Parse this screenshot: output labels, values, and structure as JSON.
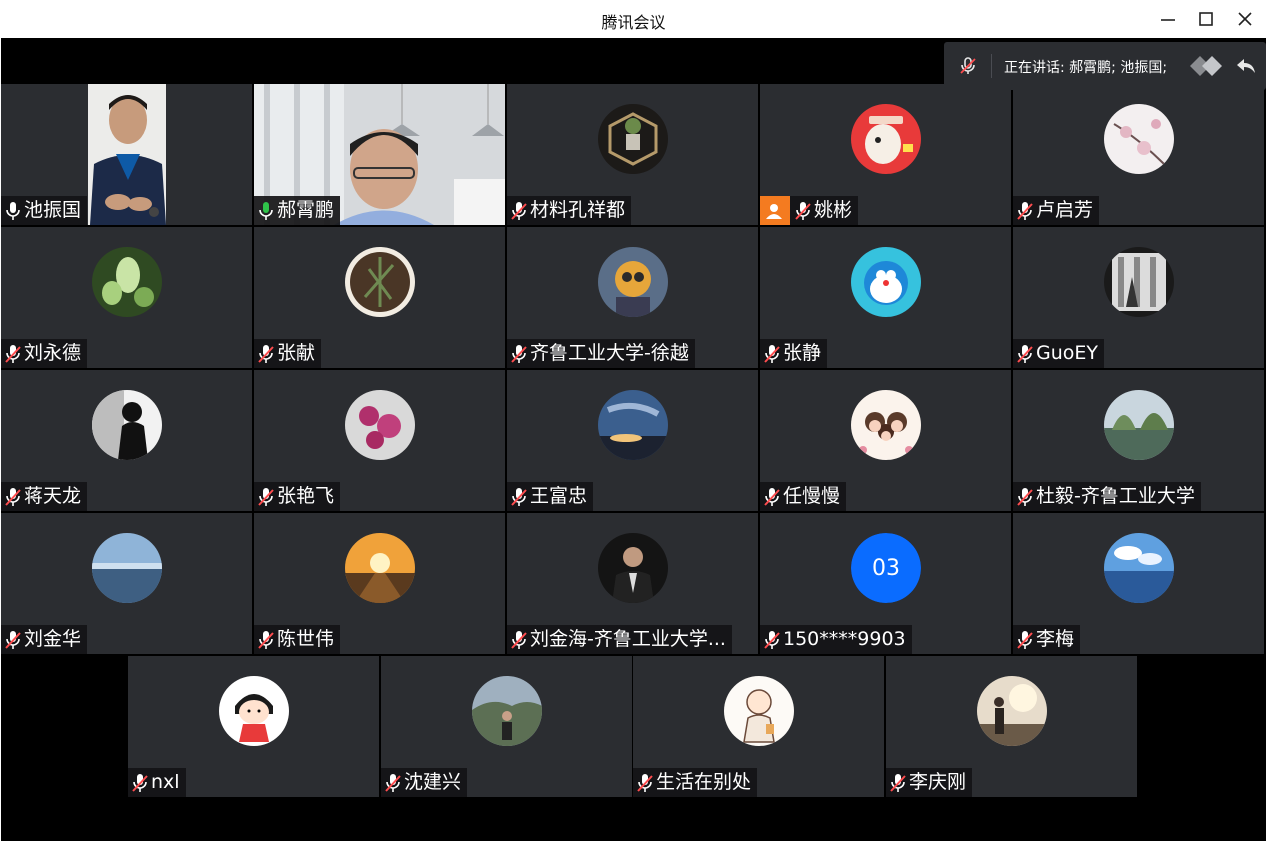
{
  "window": {
    "title": "腾讯会议",
    "controls": [
      "minimize-icon",
      "maximize-icon",
      "close-icon"
    ]
  },
  "speaking": {
    "label": "正在讲话: 郝霄鹏; 池振国;"
  },
  "colors": {
    "tile_bg": "#2b2d31",
    "stage_bg": "#000000",
    "active_border": "#2fc34a",
    "host_badge": "#f47b20",
    "number_avatar": "#0a6cff"
  },
  "participants": [
    {
      "name": "池振国",
      "mic": "on",
      "video": true
    },
    {
      "name": "郝霄鹏",
      "mic": "speaking",
      "video": true
    },
    {
      "name": "材料孔祥都",
      "mic": "muted"
    },
    {
      "name": "姚彬",
      "mic": "muted",
      "host": true
    },
    {
      "name": "卢启芳",
      "mic": "muted"
    },
    {
      "name": "刘永德",
      "mic": "muted"
    },
    {
      "name": "张献",
      "mic": "muted"
    },
    {
      "name": "齐鲁工业大学-徐越",
      "mic": "muted"
    },
    {
      "name": "张静",
      "mic": "muted"
    },
    {
      "name": "GuoEY",
      "mic": "muted"
    },
    {
      "name": "蒋天龙",
      "mic": "muted"
    },
    {
      "name": "张艳飞",
      "mic": "muted"
    },
    {
      "name": "王富忠",
      "mic": "muted"
    },
    {
      "name": "任慢慢",
      "mic": "muted"
    },
    {
      "name": "杜毅-齐鲁工业大学",
      "mic": "muted"
    },
    {
      "name": "刘金华",
      "mic": "muted"
    },
    {
      "name": "陈世伟",
      "mic": "muted"
    },
    {
      "name": "刘金海-齐鲁工业大学...",
      "mic": "muted"
    },
    {
      "name": "150****9903",
      "mic": "muted",
      "avatar_text": "03"
    },
    {
      "name": "李梅",
      "mic": "muted"
    },
    {
      "name": "nxl",
      "mic": "muted"
    },
    {
      "name": "沈建兴",
      "mic": "muted"
    },
    {
      "name": "生活在别处",
      "mic": "muted"
    },
    {
      "name": "李庆刚",
      "mic": "muted"
    }
  ]
}
